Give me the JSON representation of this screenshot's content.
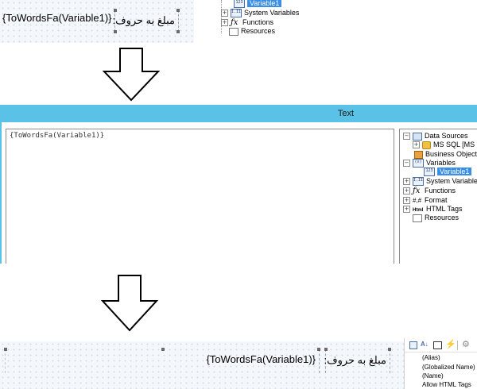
{
  "top": {
    "expression": "{ToWordsFa(Variable1)}",
    "label": "مبلغ به حروف:",
    "tree": {
      "variable1": "Variable1",
      "system_variables": "System Variables",
      "functions": "Functions",
      "resources": "Resources"
    }
  },
  "dialog": {
    "title": "Text",
    "expression": "{ToWordsFa(Variable1)}",
    "tree": {
      "data_sources": "Data Sources",
      "ms_sql": "MS SQL [MS S",
      "business_objects": "Business Objects",
      "variables": "Variables",
      "variable1": "Variable1",
      "system_variables": "System Variables",
      "functions": "Functions",
      "format": "Format",
      "html_tags": "HTML Tags",
      "resources": "Resources"
    },
    "icons": {
      "variable": "123",
      "variables": "(x)",
      "system": "I.II",
      "format": "#,#",
      "html": "Html"
    },
    "title_bar_color": "#5bc2e7"
  },
  "bottom": {
    "expression": "{ToWordsFa(Variable1)}",
    "label": "مبلغ به حروف:",
    "properties": [
      "(Alias)",
      "(Globalized Name)",
      "(Name)",
      "Allow HTML Tags"
    ]
  }
}
